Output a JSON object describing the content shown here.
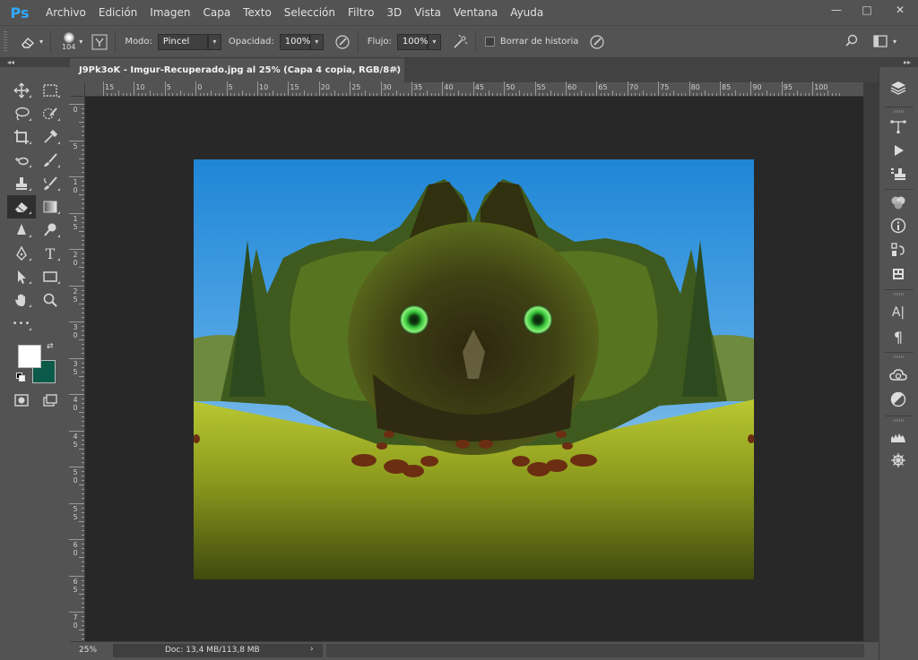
{
  "app": {
    "logo": "Ps"
  },
  "menu": [
    "Archivo",
    "Edición",
    "Imagen",
    "Capa",
    "Texto",
    "Selección",
    "Filtro",
    "3D",
    "Vista",
    "Ventana",
    "Ayuda"
  ],
  "window_controls": {
    "minimize": "—",
    "maximize": "□",
    "close": "✕"
  },
  "options": {
    "brush_size": "104",
    "mode_label": "Modo:",
    "mode_value": "Pincel",
    "opacity_label": "Opacidad:",
    "opacity_value": "100%",
    "flow_label": "Flujo:",
    "flow_value": "100%",
    "erase_history_label": "Borrar de historia",
    "erase_history_checked": false
  },
  "panel_collapse": {
    "left": "◂◂",
    "right": "▸▸"
  },
  "document": {
    "tab_title": "J9Pk3oK - Imgur-Recuperado.jpg al 25% (Capa 4 copia, RGB/8#) *",
    "tab_close": "×"
  },
  "ruler": {
    "h_labels": [
      "15",
      "10",
      "5",
      "0",
      "5",
      "10",
      "15",
      "20",
      "25",
      "30",
      "35",
      "40",
      "45",
      "50",
      "55",
      "60",
      "65",
      "70",
      "75",
      "80",
      "85",
      "90",
      "95",
      "100"
    ],
    "v_labels": [
      "0",
      "5",
      "1\n0",
      "1\n5",
      "2\n0",
      "2\n5",
      "3\n0",
      "3\n5",
      "4\n0",
      "4\n5",
      "5\n0",
      "5\n5",
      "6\n0",
      "6\n5",
      "7\n0"
    ]
  },
  "colors": {
    "foreground": "#ffffff",
    "background": "#0b5a4a",
    "accent": "#31a8ff"
  },
  "status": {
    "zoom": "25%",
    "doc_info": "Doc: 13,4 MB/113,8 MB",
    "arrow": "›"
  },
  "tools": [
    [
      "move-tool",
      "marquee-tool"
    ],
    [
      "lasso-tool",
      "quick-selection-tool"
    ],
    [
      "crop-tool",
      "eyedropper-tool"
    ],
    [
      "healing-tool",
      "brush-tool"
    ],
    [
      "clone-stamp-tool",
      "history-brush-tool"
    ],
    [
      "eraser-tool",
      "gradient-tool"
    ],
    [
      "blur-tool",
      "dodge-tool"
    ],
    [
      "pen-tool",
      "type-tool"
    ],
    [
      "path-selection-tool",
      "rectangle-tool"
    ],
    [
      "hand-tool",
      "zoom-tool"
    ],
    [
      "more-tools",
      ""
    ]
  ],
  "type_tool_glyph": "T",
  "more_tools_glyph": "•••",
  "dock": {
    "character_glyph": "A|",
    "paragraph_glyph": "¶"
  }
}
